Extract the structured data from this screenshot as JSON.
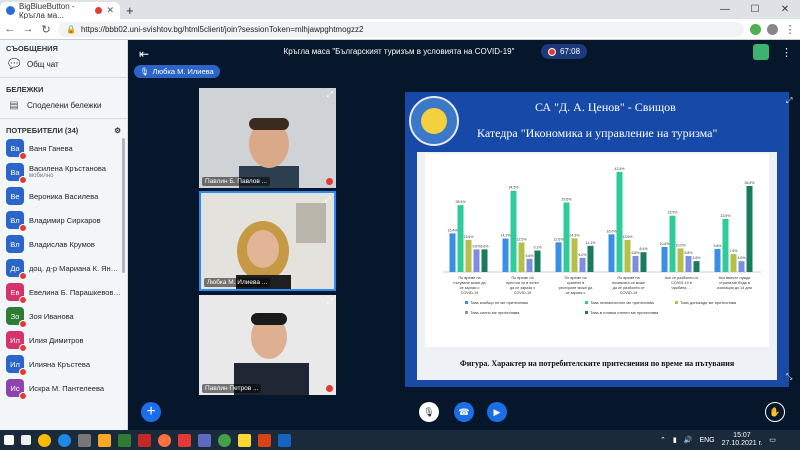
{
  "browser": {
    "tabs": [
      {
        "label": "BigBlueButton - Кръгла ма..."
      },
      {
        "label": ""
      }
    ],
    "url": "https://bbb02.uni-svishtov.bg/html5client/join?sessionToken=mlhjawpghtmogzz2"
  },
  "sidebar": {
    "messages_title": "СЪОБЩЕНИЯ",
    "public_chat": "Общ чат",
    "notes_title": "БЕЛЕЖКИ",
    "shared_notes": "Споделени бележки",
    "users_title": "ПОТРЕБИТЕЛИ (34)",
    "users": [
      {
        "initials": "Ва",
        "name": "Ваня Ганева",
        "sub": "",
        "color": "#2b65c7",
        "muted": true
      },
      {
        "initials": "Ва",
        "name": "Василена Кръстанова",
        "sub": "мобилно",
        "color": "#2b65c7",
        "muted": true
      },
      {
        "initials": "Ве",
        "name": "Вероника Василева",
        "sub": "",
        "color": "#2b65c7",
        "muted": false
      },
      {
        "initials": "Вл",
        "name": "Владимир Сирхаров",
        "sub": "",
        "color": "#2b65c7",
        "muted": true
      },
      {
        "initials": "Вл",
        "name": "Владислав Крумов",
        "sub": "",
        "color": "#2b65c7",
        "muted": false
      },
      {
        "initials": "До",
        "name": "доц. д-р Мариана К. Янева",
        "sub": "",
        "color": "#2b65c7",
        "muted": true
      },
      {
        "initials": "Ев",
        "name": "Евелина Б. Парашкевова-В...",
        "sub": "",
        "color": "#d6336c",
        "muted": true
      },
      {
        "initials": "Зо",
        "name": "Зоя Иванова",
        "sub": "",
        "color": "#2e7d32",
        "muted": true
      },
      {
        "initials": "Ил",
        "name": "Илия Димитров",
        "sub": "",
        "color": "#d6336c",
        "muted": true
      },
      {
        "initials": "Ил",
        "name": "Илияна Кръстева",
        "sub": "",
        "color": "#2b65c7",
        "muted": true
      },
      {
        "initials": "Ис",
        "name": "Искра М. Пантелеева",
        "sub": "",
        "color": "#8e44ad",
        "muted": true
      }
    ]
  },
  "header": {
    "title": "Кръгла маса \"Българският туризъм в условията на COVID-19\"",
    "timer": "67:08",
    "talker": "Любка М. Илиева"
  },
  "cameras": [
    {
      "label": "Павлин Б. Павлов ..."
    },
    {
      "label": "Любка М. Илиева ..."
    },
    {
      "label": "Павлин Петров ..."
    }
  ],
  "slide": {
    "title": "СА \"Д. А. Ценов\" - Свищов",
    "subtitle": "Катедра \"Икономика и управление на туризма\"",
    "caption": "Фигура. Характер на потребителските притеснения по време на пътувания"
  },
  "chart_data": {
    "type": "bar",
    "categories": [
      "По време на пътуване може да се заразя с COVID-19",
      "По време на престоя си в хотел да се заразя с COVID-19",
      "По време на хранене в ресторант може да се заразя с COVID-19",
      "По време на почивката си може да се разболея от COVID-19",
      "Ако се разболея от COVID-19 в чужбина, ...",
      "Ако вместо нужда страна ме бъда в изолация до 14 дни"
    ],
    "series": [
      {
        "color": "#3a8ee6",
        "values": [
          16.4,
          14.2,
          12.6,
          16.0,
          10.6,
          9.8
        ]
      },
      {
        "color": "#2ecc9a",
        "values": [
          28.4,
          34.5,
          29.5,
          42.5,
          23.9,
          22.5
        ]
      },
      {
        "color": "#b5c04a",
        "values": [
          13.6,
          12.5,
          14.3,
          13.6,
          10.0,
          7.6
        ]
      },
      {
        "color": "#7d8ee0",
        "values": [
          9.6,
          5.6,
          6.0,
          6.8,
          6.8,
          4.6
        ]
      },
      {
        "color": "#1a7a5c",
        "values": [
          9.6,
          9.1,
          11.1,
          8.4,
          4.6,
          36.5
        ]
      }
    ],
    "legend": [
      "Това изобщо не ме притеснява",
      "Това незначително ме притеснява",
      "Това донякъде ме притеснява",
      "Това силно ме притеснява",
      "Това в голяма степен ме притеснява"
    ],
    "ylim": [
      0,
      45
    ]
  },
  "taskbar": {
    "lang": "ENG",
    "time": "15:07",
    "date": "27.10.2021 г."
  }
}
